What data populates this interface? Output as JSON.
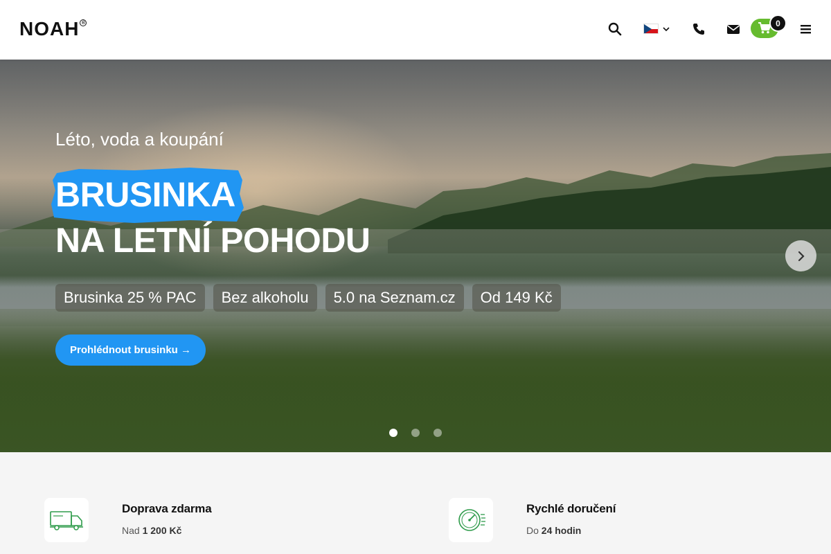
{
  "header": {
    "logo": "NOAH",
    "logo_mark": "®",
    "icons": {
      "search": "search-icon",
      "language": "czech-flag-icon",
      "phone": "phone-icon",
      "mail": "envelope-icon",
      "cart": "cart-icon",
      "menu": "hamburger-menu-icon"
    },
    "cart_count": "0"
  },
  "hero": {
    "subtitle": "Léto, voda a koupání",
    "title_line1": "BRUSINKA",
    "title_line2": "NA LETNÍ POHODU",
    "chips": [
      "Brusinka 25 % PAC",
      "Bez alkoholu",
      " 5.0 na Seznam.cz",
      "Od 149 Kč"
    ],
    "cta_label": "Prohlédnout brusinku →",
    "slide_count": 3,
    "active_slide": 1
  },
  "features": [
    {
      "icon": "truck-icon",
      "title": "Doprava zdarma",
      "sub_prefix": "Nad ",
      "sub_bold": "1 200 Kč"
    },
    {
      "icon": "speedometer-clock-icon",
      "title": "Rychlé doručení",
      "sub_prefix": "Do ",
      "sub_bold": "24 hodin"
    }
  ],
  "colors": {
    "accent_blue": "#2196f3",
    "cart_green": "#66bb2f",
    "feature_green": "#2e9b4a"
  }
}
